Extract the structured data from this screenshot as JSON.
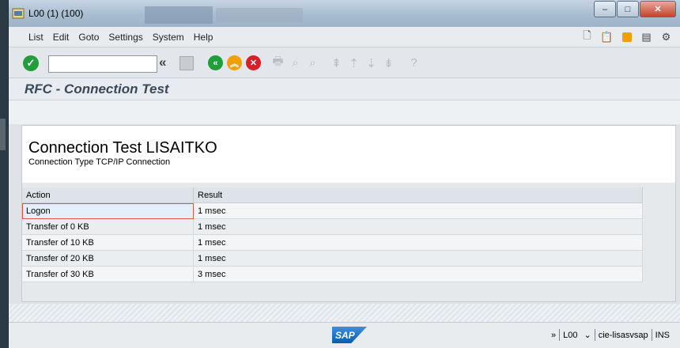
{
  "window": {
    "title": "L00 (1) (100)"
  },
  "menu": {
    "items": [
      "List",
      "Edit",
      "Goto",
      "Settings",
      "System",
      "Help"
    ]
  },
  "toolbar": {
    "command_field": ""
  },
  "screen": {
    "heading": "RFC - Connection Test"
  },
  "report": {
    "title": "Connection Test LISAITKO",
    "subtitle": "Connection Type TCP/IP Connection",
    "splitter": ",,,,,"
  },
  "table": {
    "columns": [
      "Action",
      "Result"
    ],
    "rows": [
      {
        "action": "Logon",
        "result": "1 msec"
      },
      {
        "action": "Transfer of 0 KB",
        "result": "1 msec"
      },
      {
        "action": "Transfer of 10 KB",
        "result": "1 msec"
      },
      {
        "action": "Transfer of 20 KB",
        "result": "1 msec"
      },
      {
        "action": "Transfer of 30 KB",
        "result": "3 msec"
      }
    ]
  },
  "status": {
    "logo": "SAP",
    "expand": "»",
    "system": "L00",
    "server": "cie-lisasvsap",
    "mode": "INS"
  },
  "colors": {
    "accent_green": "#1f9e3a",
    "accent_orange": "#f0a000",
    "accent_red": "#d81e28",
    "sap_blue": "#0a5cb0"
  },
  "icons": {
    "toolbar": [
      "check-icon",
      "chevron-left-icon",
      "save-icon",
      "back-icon",
      "exit-icon",
      "cancel-icon",
      "print-icon",
      "find-icon",
      "find-next-icon",
      "first-page-icon",
      "previous-page-icon",
      "next-page-icon",
      "last-page-icon",
      "help-icon"
    ],
    "menu": [
      "document-icon",
      "clipboard-icon",
      "layout-icon",
      "monitor-icon",
      "settings-icon"
    ]
  }
}
